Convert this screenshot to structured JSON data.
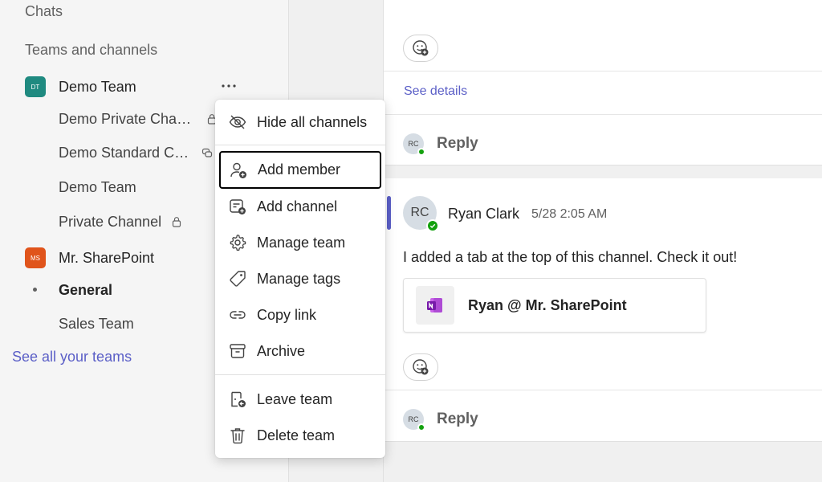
{
  "sidebar": {
    "chats_label": "Chats",
    "teams_label": "Teams and channels",
    "teams": [
      {
        "initials": "DT",
        "color": "#1f8a80",
        "name": "Demo Team",
        "channels": [
          {
            "name": "Demo Private Channel",
            "icon": "lock-icon"
          },
          {
            "name": "Demo Standard Channel",
            "icon": "shared-channel-icon"
          },
          {
            "name": "Demo Team"
          },
          {
            "name": "Private Channel",
            "icon": "lock-icon"
          }
        ]
      },
      {
        "initials": "MS",
        "color": "#e0541b",
        "name": "Mr. SharePoint",
        "channels": [
          {
            "name": "General",
            "selected": true
          },
          {
            "name": "Sales Team"
          }
        ]
      }
    ],
    "see_all": "See all your teams"
  },
  "context_menu": {
    "items": [
      {
        "label": "Hide all channels",
        "icon": "eye-off-icon"
      },
      {
        "label": "Add member",
        "icon": "person-add-icon",
        "focused": true
      },
      {
        "label": "Add channel",
        "icon": "channel-add-icon"
      },
      {
        "label": "Manage team",
        "icon": "gear-icon"
      },
      {
        "label": "Manage tags",
        "icon": "tag-icon"
      },
      {
        "label": "Copy link",
        "icon": "link-icon"
      },
      {
        "label": "Archive",
        "icon": "archive-icon"
      },
      {
        "label": "Leave team",
        "icon": "leave-icon"
      },
      {
        "label": "Delete team",
        "icon": "trash-icon"
      }
    ]
  },
  "conversation": {
    "see_details": "See details",
    "reply_label": "Reply",
    "reply_avatar": "RC",
    "message": {
      "author_initials": "RC",
      "author": "Ryan Clark",
      "time": "5/28 2:05 AM",
      "text": "I added a tab at the top of this channel. Check it out!",
      "tab_card_title": "Ryan @ Mr. SharePoint",
      "tab_card_icon": "onenote-icon"
    }
  },
  "colors": {
    "accent": "#5b5fc7",
    "presence": "#13a10e"
  }
}
